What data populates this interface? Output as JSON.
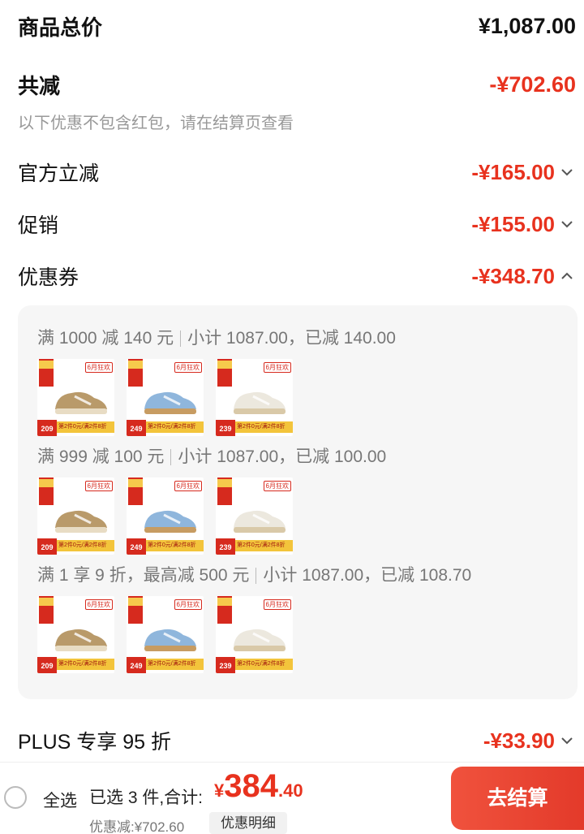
{
  "summary": {
    "total_label": "商品总价",
    "total_value": "¥1,087.00",
    "reduce_label": "共减",
    "reduce_value": "-¥702.60",
    "note": "以下优惠不包含红包，请在结算页查看"
  },
  "discounts": {
    "official_label": "官方立减",
    "official_value": "-¥165.00",
    "promo_label": "促销",
    "promo_value": "-¥155.00",
    "coupon_label": "优惠券",
    "coupon_value": "-¥348.70",
    "plus_label": "PLUS 专享 95 折",
    "plus_value": "-¥33.90"
  },
  "coupon_rules": [
    {
      "condition": "满 1000 减 140 元",
      "detail": "小计 1087.00，已减 140.00"
    },
    {
      "condition": "满 999 减 100 元",
      "detail": "小计 1087.00，已减 100.00"
    },
    {
      "condition": "满 1 享 9 折，最高减 500 元",
      "detail": "小计 1087.00，已减 108.70"
    }
  ],
  "products": [
    {
      "price": "209",
      "color": "#b99a6a",
      "sole": "#e8dcc4",
      "tag": "6月狂欢",
      "band": "第2件0元/满2件8折"
    },
    {
      "price": "249",
      "color": "#8fb6dc",
      "sole": "#c79c62",
      "tag": "6月狂欢",
      "band": "第2件0元/满2件8折"
    },
    {
      "price": "239",
      "color": "#ece8de",
      "sole": "#d9c9a8",
      "tag": "6月狂欢",
      "band": "第2件0元/满2件8折"
    }
  ],
  "footer": {
    "select_all": "全选",
    "selected_text": "已选 3 件,合计:",
    "currency": "¥",
    "total_int": "384",
    "total_dec": ".40",
    "saved_text": "优惠减:¥702.60",
    "detail_button": "优惠明细",
    "checkout_button": "去结算"
  }
}
